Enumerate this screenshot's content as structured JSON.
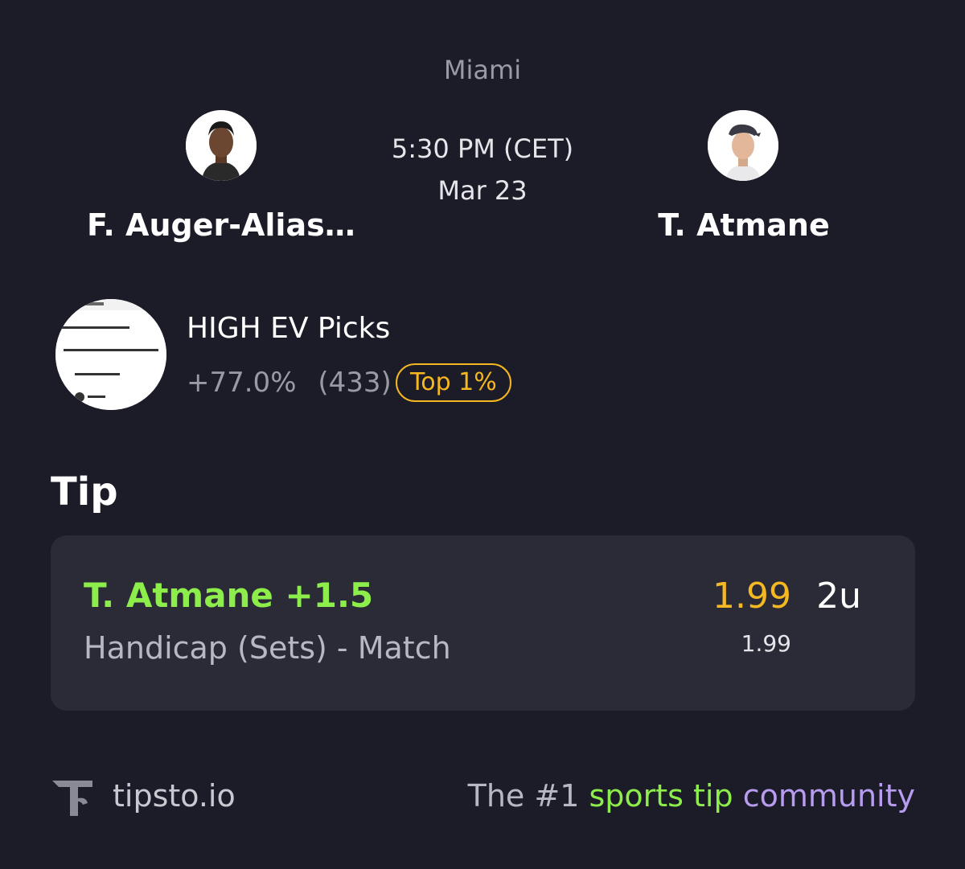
{
  "match": {
    "venue": "Miami",
    "time": "5:30 PM (CET)",
    "date": "Mar 23",
    "home_player": "F. Auger-Aliassime",
    "away_player": "T. Atmane"
  },
  "tipster": {
    "name": "HIGH EV Picks",
    "yield": "+77.0%",
    "count": "(433)",
    "rank_badge": "Top 1%"
  },
  "tip": {
    "section_title": "Tip",
    "selection": "T. Atmane +1.5",
    "market": "Handicap (Sets) - Match",
    "odds": "1.99",
    "stake": "2u",
    "odds_sub": "1.99"
  },
  "footer": {
    "brand": "tipsto.io",
    "slogan_part1": "The #1 ",
    "slogan_part2": "sports tip",
    "slogan_part3": " community"
  },
  "colors": {
    "background": "#1c1c28",
    "card": "#2b2b38",
    "accent_green": "#8ded4a",
    "accent_gold": "#f5b820",
    "accent_purple": "#b79cf0"
  },
  "icons": {
    "home_avatar": "player-photo",
    "away_avatar": "player-photo",
    "tipster_avatar": "tipster-photo",
    "brand_logo": "tipsto-logo-icon"
  }
}
